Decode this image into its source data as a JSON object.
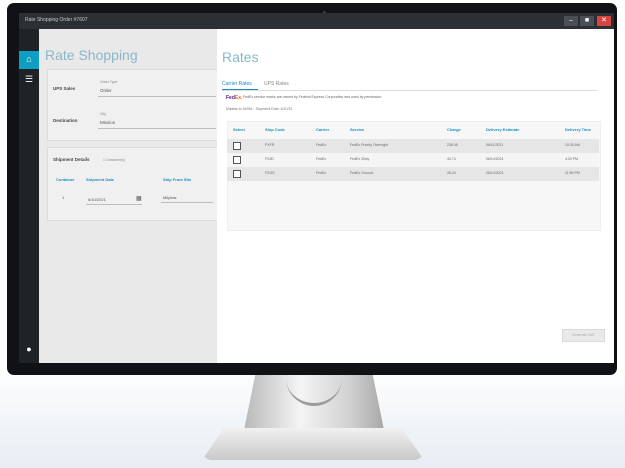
{
  "window": {
    "title": "Rate Shopping Order #7607",
    "minimize": "‒",
    "maximize": "■",
    "close": "✕"
  },
  "nav": {
    "icons": [
      "home-icon",
      "menu-icon",
      "user-icon"
    ]
  },
  "left_panel": {
    "title": "Rate Shopping",
    "ups_sales": {
      "label": "UPS Sales",
      "field_label": "Order Type",
      "value": "Order"
    },
    "destination": {
      "label": "Destination",
      "field_label": "City",
      "value": "Mission"
    },
    "shipment_details": {
      "label": "Shipment Details",
      "count_text": "1 Container(s)",
      "columns": [
        "Container",
        "Shipment Date",
        "Ship From Site"
      ],
      "row": [
        "1",
        "6/10/2021",
        "Milpitas"
      ]
    }
  },
  "rates": {
    "title": "Rates",
    "tabs": [
      "Carrier Rates",
      "UPS Rates"
    ],
    "fedex_logo": {
      "fe": "Fed",
      "ex": "Ex."
    },
    "fedex_notice": "FedEx service marks are owned by Federal Express Corporation and used by permission.",
    "ship_note": "Milpitas to 94954 - Shipment Date: 6/10/21",
    "columns": [
      "Select",
      "Ship Code",
      "Carrier",
      "Service",
      "Charge",
      "Delivery Estimate",
      "Delivery Time"
    ],
    "rows": [
      [
        "",
        "PXFR",
        "FedEx",
        "FedEx Priority Overnight",
        "236.05",
        "06/11/2021",
        "10:30 AM"
      ],
      [
        "",
        "FX2D",
        "FedEx",
        "FedEx 2Day",
        "40.74",
        "06/14/2021",
        "4:30 PM"
      ],
      [
        "",
        "FXGS",
        "FedEx",
        "FedEx Ground",
        "26.24",
        "06/14/2021",
        "11:59 PM"
      ]
    ],
    "action_button": "Generate CMT"
  }
}
